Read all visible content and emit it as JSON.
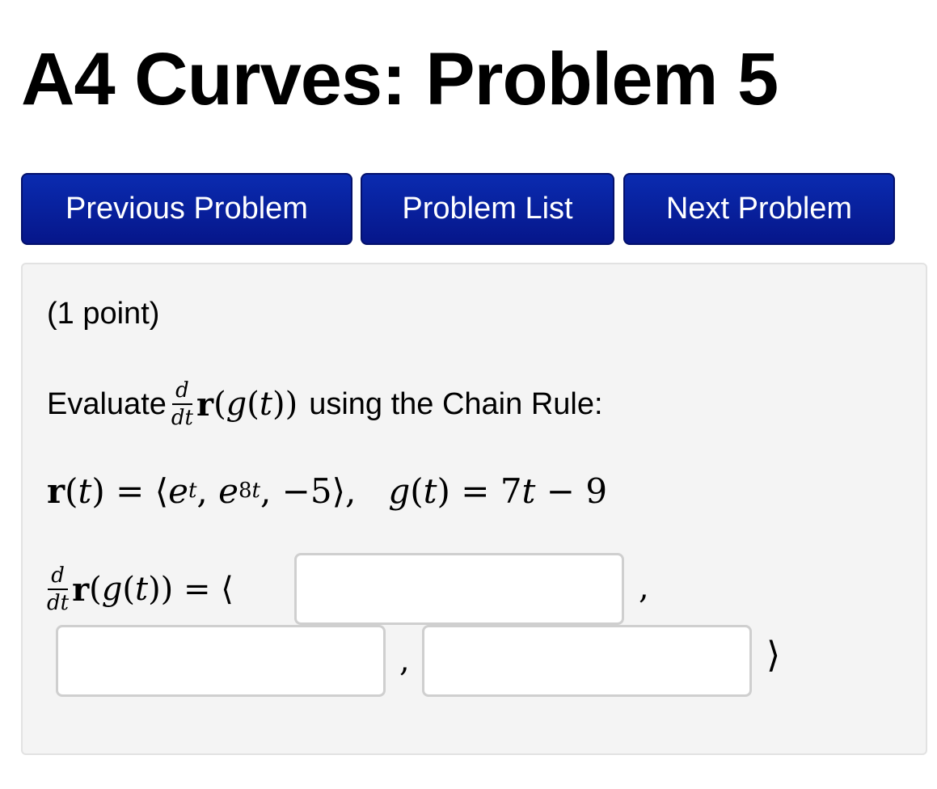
{
  "header": {
    "title": "A4 Curves: Problem 5"
  },
  "nav": {
    "previous_label": "Previous Problem",
    "list_label": "Problem List",
    "next_label": "Next Problem"
  },
  "problem": {
    "points_text": "(1 point)",
    "prompt_prefix": "Evaluate",
    "prompt_suffix": "using the Chain Rule:",
    "derivative_numerator": "d",
    "derivative_denominator": "dt",
    "target_expression": "r(g(t))",
    "definition": {
      "r_lhs": "r(t) =",
      "r_components": [
        "e",
        "t",
        "e",
        "8t",
        "−5"
      ],
      "g_lhs": "g(t) =",
      "g_rhs": "7t − 9"
    },
    "answer": {
      "lhs_suffix": "=",
      "langle": "⟨",
      "rangle": "⟩",
      "separator": ",",
      "inputs": [
        {
          "value": "",
          "placeholder": ""
        },
        {
          "value": "",
          "placeholder": ""
        },
        {
          "value": "",
          "placeholder": ""
        }
      ]
    }
  },
  "colors": {
    "button_bg": "#0a2bb0",
    "button_text": "#ffffff",
    "problem_bg": "#f4f4f4"
  }
}
